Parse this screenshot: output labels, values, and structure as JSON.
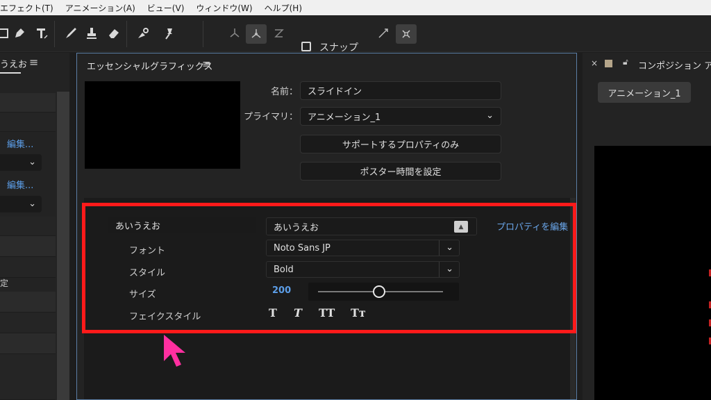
{
  "menubar": {
    "items": [
      "エフェクト(T)",
      "アニメーション(A)",
      "ビュー(V)",
      "ウィンドウ(W)",
      "ヘルプ(H)"
    ]
  },
  "toolbar": {
    "snap_label": "スナップ"
  },
  "left_panel": {
    "title_fragment": "うえお",
    "edit_link_1": "編集...",
    "edit_link_2": "編集...",
    "text_fragment": "定"
  },
  "essential_graphics": {
    "title": "エッセンシャルグラフィックス",
    "name_label": "名前：",
    "name_value": "スライドイン",
    "primary_label": "プライマリ：",
    "primary_value": "アニメーション_1",
    "supported_props_button": "サポートするプロパティのみ",
    "poster_time_button": "ポスター時間を設定",
    "text_property": {
      "name": "あいうえお",
      "source_text": "あいうえお",
      "edit_properties_link": "プロパティを編集",
      "font_label": "フォント",
      "font_value": "Noto Sans JP",
      "style_label": "スタイル",
      "style_value": "Bold",
      "size_label": "サイズ",
      "size_value": "200",
      "size_slider_fraction": 0.49,
      "faux_style_label": "フェイクスタイル",
      "faux_buttons": [
        "T",
        "T",
        "TT",
        "Tт"
      ]
    }
  },
  "right_panel": {
    "title": "コンポジション アニ",
    "tab_label": "アニメーション_1",
    "swatch_color": "#b5a58a"
  },
  "colors": {
    "highlight_frame": "#ff1a1a",
    "cursor": "#ff2fa0",
    "link": "#5c9ee8"
  }
}
